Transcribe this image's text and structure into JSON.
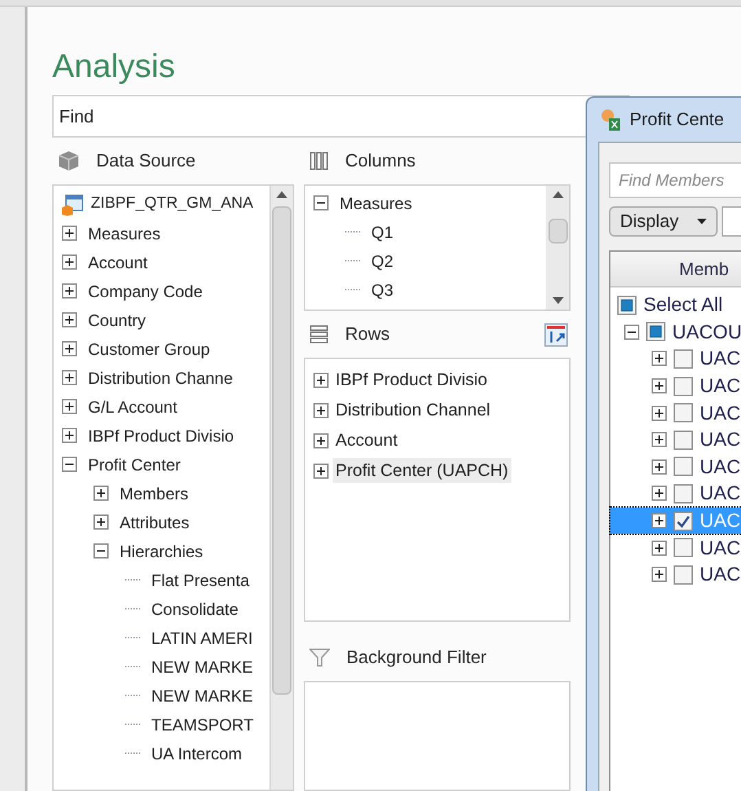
{
  "title": "Analysis",
  "find": {
    "placeholder": "Find"
  },
  "data_source": {
    "title": "Data Source",
    "root": "ZIBPF_QTR_GM_ANA",
    "items": [
      {
        "label": "Measures",
        "expanded": false
      },
      {
        "label": "Account",
        "expanded": false
      },
      {
        "label": "Company Code",
        "expanded": false
      },
      {
        "label": "Country",
        "expanded": false
      },
      {
        "label": "Customer Group",
        "expanded": false
      },
      {
        "label": "Distribution Channe",
        "expanded": false
      },
      {
        "label": "G/L Account",
        "expanded": false
      },
      {
        "label": "IBPf Product Divisio",
        "expanded": false
      },
      {
        "label": "Profit Center",
        "expanded": true,
        "children": [
          {
            "label": "Members",
            "expanded": false
          },
          {
            "label": "Attributes",
            "expanded": false
          },
          {
            "label": "Hierarchies",
            "expanded": true,
            "children": [
              {
                "label": "Flat Presenta"
              },
              {
                "label": "Consolidate"
              },
              {
                "label": "LATIN AMERI"
              },
              {
                "label": "NEW MARKE"
              },
              {
                "label": "NEW MARKE"
              },
              {
                "label": "TEAMSPORT"
              },
              {
                "label": "UA Intercom"
              }
            ]
          }
        ]
      }
    ]
  },
  "columns": {
    "title": "Columns",
    "items": [
      {
        "label": "Measures",
        "expanded": true,
        "children": [
          {
            "label": "Q1"
          },
          {
            "label": "Q2"
          },
          {
            "label": "Q3"
          }
        ]
      }
    ]
  },
  "rows": {
    "title": "Rows",
    "items": [
      {
        "label": "IBPf Product Divisio",
        "expanded": false,
        "selected": false
      },
      {
        "label": "Distribution Channel",
        "expanded": false,
        "selected": false
      },
      {
        "label": "Account",
        "expanded": false,
        "selected": false
      },
      {
        "label": "Profit Center (UAPCH)",
        "expanded": false,
        "selected": true
      }
    ]
  },
  "background_filter": {
    "title": "Background Filter"
  },
  "dialog": {
    "title": "Profit Cente",
    "search": {
      "placeholder": "Find Members"
    },
    "display_button": "Display",
    "column_header": "Memb",
    "select_all": {
      "label": "Select All",
      "checked": false,
      "partial": true
    },
    "members": [
      {
        "label": "UACOU",
        "expanded": true,
        "checked": false,
        "partial": true,
        "selected": false,
        "children": [
          {
            "label": "UAC",
            "expanded": false,
            "checked": false,
            "partial": false,
            "selected": false
          },
          {
            "label": "UAC",
            "expanded": false,
            "checked": false,
            "partial": false,
            "selected": false
          },
          {
            "label": "UAC",
            "expanded": false,
            "checked": false,
            "partial": false,
            "selected": false
          },
          {
            "label": "UAC",
            "expanded": false,
            "checked": false,
            "partial": false,
            "selected": false
          },
          {
            "label": "UAC",
            "expanded": false,
            "checked": false,
            "partial": false,
            "selected": false
          },
          {
            "label": "UAC",
            "expanded": false,
            "checked": false,
            "partial": false,
            "selected": false
          },
          {
            "label": "UAC",
            "expanded": false,
            "checked": true,
            "partial": false,
            "selected": true
          },
          {
            "label": "UAC",
            "expanded": false,
            "checked": false,
            "partial": false,
            "selected": false
          },
          {
            "label": "UAC",
            "expanded": false,
            "checked": false,
            "partial": false,
            "selected": false
          }
        ]
      }
    ]
  }
}
